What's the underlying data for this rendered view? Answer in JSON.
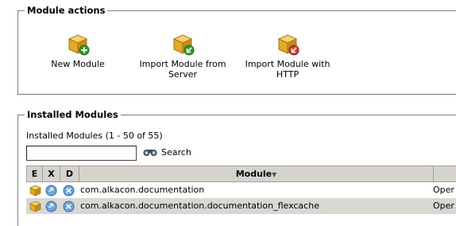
{
  "module_actions": {
    "title": "Module actions",
    "actions": [
      {
        "line1": "New Module",
        "line2": "",
        "icon": "package-new-icon"
      },
      {
        "line1": "Import Module from",
        "line2": "Server",
        "icon": "package-import-server-icon"
      },
      {
        "line1": "Import Module with",
        "line2": "HTTP",
        "icon": "package-import-http-icon"
      }
    ]
  },
  "installed_modules": {
    "title": "Installed Modules",
    "count_text": "Installed Modules (1 - 50 of 55)",
    "search": {
      "value": "",
      "button_label": "Search"
    },
    "columns": {
      "e": "E",
      "x": "X",
      "d": "D",
      "module": "Module",
      "last": ""
    },
    "rows": [
      {
        "name": "com.alkacon.documentation",
        "col": "Oper"
      },
      {
        "name": "com.alkacon.documentation.documentation_flexcache",
        "col": "Oper"
      }
    ]
  },
  "colors": {
    "header_bg": "#d6d3ce",
    "row_alt_bg": "#d9d7d2",
    "border": "#7a7a7a"
  }
}
